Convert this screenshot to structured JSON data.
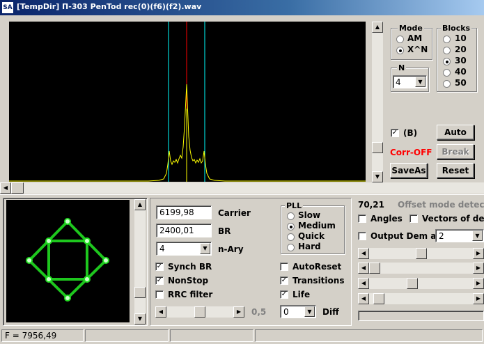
{
  "window": {
    "title": "[TempDir] П-303 PenTod rec(0)(f6)(f2).wav",
    "icon_text": "SA"
  },
  "mode": {
    "title": "Mode",
    "options": [
      "AM",
      "X^N"
    ],
    "selected": "X^N"
  },
  "blocks": {
    "title": "Blocks",
    "options": [
      "10",
      "20",
      "30",
      "40",
      "50"
    ],
    "selected": "30"
  },
  "n": {
    "title": "N",
    "value": "4"
  },
  "b_checkbox": {
    "label": "(B)",
    "checked": true
  },
  "corr_status": {
    "text": "Corr-OFF",
    "color": "#ff0000"
  },
  "buttons": {
    "auto": "Auto",
    "break": "Break",
    "saveas": "SaveAs",
    "reset": "Reset"
  },
  "carrier": {
    "value": "6199,98",
    "label": "Carrier"
  },
  "br": {
    "value": "2400,01",
    "label": "BR"
  },
  "nary": {
    "value": "4",
    "label": "n-Ary"
  },
  "pll": {
    "title": "PLL",
    "options": [
      "Slow",
      "Medium",
      "Quick",
      "Hard"
    ],
    "selected": "Medium"
  },
  "checks_left": [
    {
      "label": "Synch BR",
      "checked": true
    },
    {
      "label": "NonStop",
      "checked": true
    },
    {
      "label": "RRC filter",
      "checked": false
    }
  ],
  "checks_right": [
    {
      "label": "AutoReset",
      "checked": false
    },
    {
      "label": "Transitions",
      "checked": true
    },
    {
      "label": "Life",
      "checked": true
    }
  ],
  "slider_value": "0,5",
  "diff": {
    "value": "0",
    "label": "Diff"
  },
  "offset": {
    "value": "70,21",
    "status": "Offset mode detected"
  },
  "angles": {
    "label": "Angles",
    "checked": false
  },
  "vectors": {
    "label": "Vectors of dem",
    "checked": false
  },
  "output_dem": {
    "label": "Output Dem as",
    "value": "2",
    "checked": false
  },
  "status_bar": {
    "frequency": "F = 7956,49"
  },
  "colors": {
    "spectrum": "#ffff00",
    "cursor_center": "#ff0000",
    "cursor_side": "#00ffff",
    "constellation": "#00ff00",
    "corr_off": "#ff0000"
  }
}
